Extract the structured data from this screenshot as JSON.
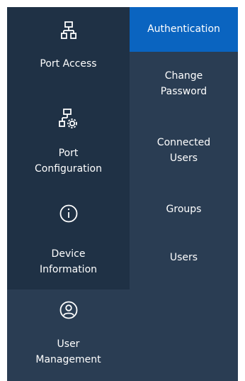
{
  "nav": {
    "items": [
      {
        "label": "Port Access",
        "icon": "network-hierarchy-icon"
      },
      {
        "label": "Port\nConfiguration",
        "icon": "network-settings-icon"
      },
      {
        "label": "Device\nInformation",
        "icon": "info-icon"
      },
      {
        "label": "User\nManagement",
        "icon": "user-icon"
      }
    ],
    "selected": "User\nManagement"
  },
  "submenu": {
    "items": [
      {
        "label": "Authentication"
      },
      {
        "label": "Change\nPassword"
      },
      {
        "label": "Connected\nUsers"
      },
      {
        "label": "Groups"
      },
      {
        "label": "Users"
      }
    ],
    "selected": "Authentication"
  },
  "colors": {
    "left_bg": "#1f3145",
    "panel_bg": "#2a3d53",
    "accent": "#0a64c0",
    "text": "#ffffff"
  }
}
